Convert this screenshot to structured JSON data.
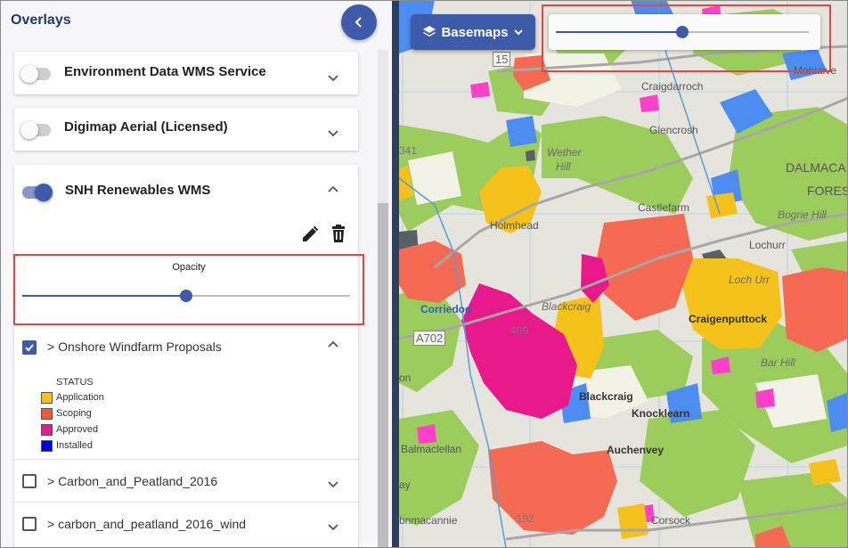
{
  "sidebar": {
    "title": "Overlays",
    "layers": [
      {
        "name": "Environment Data WMS Service",
        "enabled": false
      },
      {
        "name": "Digimap Aerial (Licensed)",
        "enabled": false
      },
      {
        "name": "SNH Renewables WMS",
        "enabled": true
      }
    ],
    "opacity": {
      "label": "Opacity",
      "value": 0.5
    },
    "sublayers": [
      {
        "label": "> Onshore Windfarm Proposals",
        "checked": true
      },
      {
        "label": "> Carbon_and_Peatland_2016",
        "checked": false
      },
      {
        "label": "> carbon_and_peatland_2016_wind",
        "checked": false
      }
    ],
    "legend": {
      "title": "STATUS",
      "items": [
        {
          "label": "Application",
          "color": "#f5c21b"
        },
        {
          "label": "Scoping",
          "color": "#f05a3c"
        },
        {
          "label": "Approved",
          "color": "#e8198b"
        },
        {
          "label": "Installed",
          "color": "#0000ee"
        }
      ]
    }
  },
  "map": {
    "basemaps_label": "Basemaps",
    "opacity_value": 0.5,
    "places": {
      "craigdarroch": "Craigdarroch",
      "glencrosh": "Glencrosh",
      "wether": "Wether",
      "hill": "Hill",
      "castlefarm": "Castlefarm",
      "holmhead": "Holmhead",
      "corriedoo": "Corriedoo",
      "blackcraig_upper": "Blackcraig",
      "blackcraig": "Blackcraig",
      "knocklearn": "Knocklearn",
      "auchenvey": "Auchenvey",
      "craigenputtock": "Craigenputtock",
      "bogrie_hill": "Bogrie Hill",
      "lochurr": "Lochurr",
      "loch_urr": "Loch Urr",
      "bar_hill": "Bar Hill",
      "dalmaca": "DALMACA",
      "fores": "FORES",
      "moniaive": "Moniaive",
      "balmaclellan": "Balmaclellan",
      "bnmacannie": "bnmacannie",
      "corsock": "Corsock",
      "edge_a": "ay",
      "edge_b": "on"
    },
    "roads": {
      "a702": "A702",
      "r15": "15"
    },
    "heights": {
      "h341": "341",
      "h409": "409",
      "h192": "192"
    }
  },
  "colors": {
    "accent": "#3d5ba8",
    "highlight": "#e04848"
  }
}
